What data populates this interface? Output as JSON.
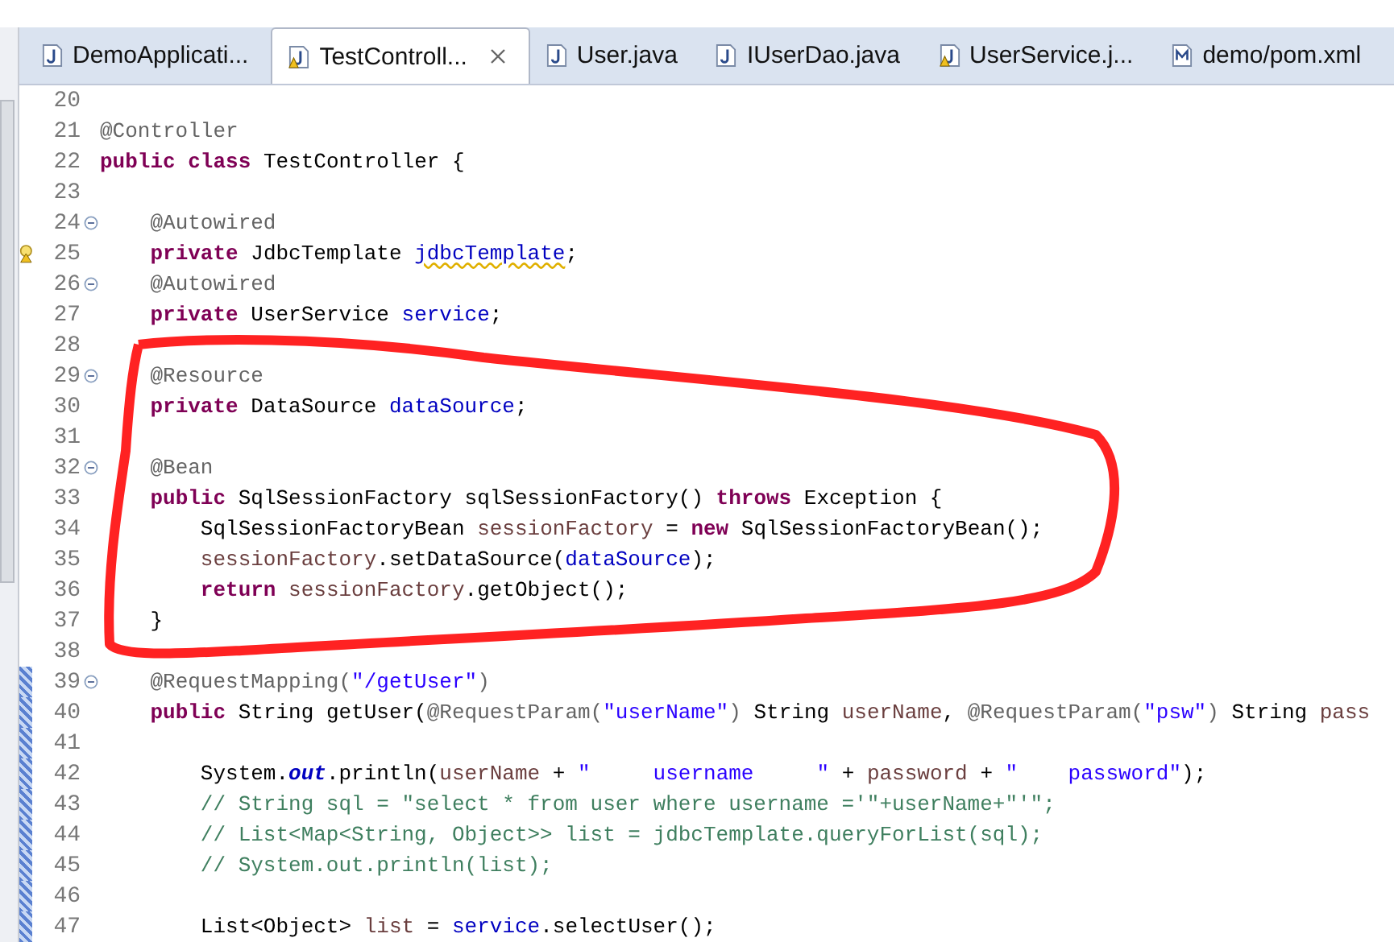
{
  "tabs": [
    {
      "label": "DemoApplicati...",
      "kind": "java",
      "warning": false,
      "selected": false
    },
    {
      "label": "TestControll...",
      "kind": "java",
      "warning": true,
      "selected": true
    },
    {
      "label": "User.java",
      "kind": "java",
      "warning": false,
      "selected": false
    },
    {
      "label": "IUserDao.java",
      "kind": "java",
      "warning": false,
      "selected": false
    },
    {
      "label": "UserService.j...",
      "kind": "java",
      "warning": true,
      "selected": false
    },
    {
      "label": "demo/pom.xml",
      "kind": "maven",
      "warning": false,
      "selected": false
    }
  ],
  "lines": [
    {
      "number": "20",
      "foldable": false,
      "warning": false,
      "changed": false
    },
    {
      "number": "21",
      "foldable": false,
      "warning": false,
      "changed": false,
      "tokens": [
        {
          "kind": "ann",
          "t": "@Controller"
        }
      ]
    },
    {
      "number": "22",
      "foldable": false,
      "warning": false,
      "changed": false,
      "tokens": [
        {
          "kind": "kw",
          "t": "public"
        },
        {
          "kind": "kw",
          "t": " class"
        },
        {
          "kind": "plain",
          "t": " TestController {"
        }
      ]
    },
    {
      "number": "23",
      "foldable": false,
      "warning": false,
      "changed": false
    },
    {
      "number": "24",
      "foldable": true,
      "warning": false,
      "changed": false,
      "tokens": [
        {
          "kind": "ann",
          "t": "    @Autowired"
        }
      ]
    },
    {
      "number": "25",
      "foldable": false,
      "warning": true,
      "changed": false,
      "tokens": [
        {
          "kind": "kw",
          "t": "    private"
        },
        {
          "kind": "plain",
          "t": " JdbcTemplate "
        },
        {
          "kind": "field-warn",
          "t": "jdbcTemplate"
        },
        {
          "kind": "plain",
          "t": ";"
        }
      ]
    },
    {
      "number": "26",
      "foldable": true,
      "warning": false,
      "changed": false,
      "tokens": [
        {
          "kind": "ann",
          "t": "    @Autowired"
        }
      ]
    },
    {
      "number": "27",
      "foldable": false,
      "warning": false,
      "changed": false,
      "tokens": [
        {
          "kind": "kw",
          "t": "    private"
        },
        {
          "kind": "plain",
          "t": " UserService "
        },
        {
          "kind": "field",
          "t": "service"
        },
        {
          "kind": "plain",
          "t": ";"
        }
      ]
    },
    {
      "number": "28",
      "foldable": false,
      "warning": false,
      "changed": false
    },
    {
      "number": "29",
      "foldable": true,
      "warning": false,
      "changed": false,
      "tokens": [
        {
          "kind": "ann",
          "t": "    @Resource"
        }
      ]
    },
    {
      "number": "30",
      "foldable": false,
      "warning": false,
      "changed": false,
      "tokens": [
        {
          "kind": "kw",
          "t": "    private"
        },
        {
          "kind": "plain",
          "t": " DataSource "
        },
        {
          "kind": "field",
          "t": "dataSource"
        },
        {
          "kind": "plain",
          "t": ";"
        }
      ]
    },
    {
      "number": "31",
      "foldable": false,
      "warning": false,
      "changed": false
    },
    {
      "number": "32",
      "foldable": true,
      "warning": false,
      "changed": false,
      "tokens": [
        {
          "kind": "ann",
          "t": "    @Bean"
        }
      ]
    },
    {
      "number": "33",
      "foldable": false,
      "warning": false,
      "changed": false,
      "tokens": [
        {
          "kind": "kw",
          "t": "    public"
        },
        {
          "kind": "plain",
          "t": " SqlSessionFactory sqlSessionFactory() "
        },
        {
          "kind": "kw",
          "t": "throws"
        },
        {
          "kind": "plain",
          "t": " Exception {"
        }
      ]
    },
    {
      "number": "34",
      "foldable": false,
      "warning": false,
      "changed": false,
      "tokens": [
        {
          "kind": "plain",
          "t": "        SqlSessionFactoryBean "
        },
        {
          "kind": "var",
          "t": "sessionFactory"
        },
        {
          "kind": "plain",
          "t": " = "
        },
        {
          "kind": "kw",
          "t": "new"
        },
        {
          "kind": "plain",
          "t": " SqlSessionFactoryBean();"
        }
      ]
    },
    {
      "number": "35",
      "foldable": false,
      "warning": false,
      "changed": false,
      "tokens": [
        {
          "kind": "var",
          "t": "        sessionFactory"
        },
        {
          "kind": "plain",
          "t": ".setDataSource("
        },
        {
          "kind": "field",
          "t": "dataSource"
        },
        {
          "kind": "plain",
          "t": ");"
        }
      ]
    },
    {
      "number": "36",
      "foldable": false,
      "warning": false,
      "changed": false,
      "tokens": [
        {
          "kind": "kw",
          "t": "        return"
        },
        {
          "kind": "var",
          "t": " sessionFactory"
        },
        {
          "kind": "plain",
          "t": ".getObject();"
        }
      ]
    },
    {
      "number": "37",
      "foldable": false,
      "warning": false,
      "changed": false,
      "tokens": [
        {
          "kind": "plain",
          "t": "    }"
        }
      ]
    },
    {
      "number": "38",
      "foldable": false,
      "warning": false,
      "changed": false
    },
    {
      "number": "39",
      "foldable": true,
      "warning": false,
      "changed": true,
      "tokens": [
        {
          "kind": "ann",
          "t": "    @RequestMapping("
        },
        {
          "kind": "str",
          "t": "\"/getUser\""
        },
        {
          "kind": "ann",
          "t": ")"
        }
      ]
    },
    {
      "number": "40",
      "foldable": false,
      "warning": false,
      "changed": true,
      "tokens": [
        {
          "kind": "kw",
          "t": "    public"
        },
        {
          "kind": "plain",
          "t": " String getUser("
        },
        {
          "kind": "ann",
          "t": "@RequestParam("
        },
        {
          "kind": "str",
          "t": "\"userName\""
        },
        {
          "kind": "ann",
          "t": ")"
        },
        {
          "kind": "plain",
          "t": " String "
        },
        {
          "kind": "var",
          "t": "userName"
        },
        {
          "kind": "plain",
          "t": ", "
        },
        {
          "kind": "ann",
          "t": "@RequestParam("
        },
        {
          "kind": "str",
          "t": "\"psw\""
        },
        {
          "kind": "ann",
          "t": ")"
        },
        {
          "kind": "plain",
          "t": " String "
        },
        {
          "kind": "var",
          "t": "pass"
        }
      ]
    },
    {
      "number": "41",
      "foldable": false,
      "warning": false,
      "changed": true
    },
    {
      "number": "42",
      "foldable": false,
      "warning": false,
      "changed": true,
      "tokens": [
        {
          "kind": "plain",
          "t": "        System."
        },
        {
          "kind": "static",
          "t": "out"
        },
        {
          "kind": "plain",
          "t": ".println("
        },
        {
          "kind": "var",
          "t": "userName"
        },
        {
          "kind": "plain",
          "t": " + "
        },
        {
          "kind": "str",
          "t": "\"     username     \""
        },
        {
          "kind": "plain",
          "t": " + "
        },
        {
          "kind": "var",
          "t": "password"
        },
        {
          "kind": "plain",
          "t": " + "
        },
        {
          "kind": "str",
          "t": "\"    password\""
        },
        {
          "kind": "plain",
          "t": ");"
        }
      ]
    },
    {
      "number": "43",
      "foldable": false,
      "warning": false,
      "changed": true,
      "tokens": [
        {
          "kind": "comment",
          "t": "        // String sql = \"select * from user where username ='\"+userName+\"'\";"
        }
      ]
    },
    {
      "number": "44",
      "foldable": false,
      "warning": false,
      "changed": true,
      "tokens": [
        {
          "kind": "comment",
          "t": "        // List<Map<String, Object>> list = jdbcTemplate.queryForList(sql);"
        }
      ]
    },
    {
      "number": "45",
      "foldable": false,
      "warning": false,
      "changed": true,
      "tokens": [
        {
          "kind": "comment",
          "t": "        // System.out.println(list);"
        }
      ]
    },
    {
      "number": "46",
      "foldable": false,
      "warning": false,
      "changed": true
    },
    {
      "number": "47",
      "foldable": false,
      "warning": false,
      "changed": true,
      "tokens": [
        {
          "kind": "plain",
          "t": "        List<Object> "
        },
        {
          "kind": "var",
          "t": "list"
        },
        {
          "kind": "plain",
          "t": " = "
        },
        {
          "kind": "field",
          "t": "service"
        },
        {
          "kind": "plain",
          "t": ".selectUser();"
        }
      ]
    }
  ]
}
